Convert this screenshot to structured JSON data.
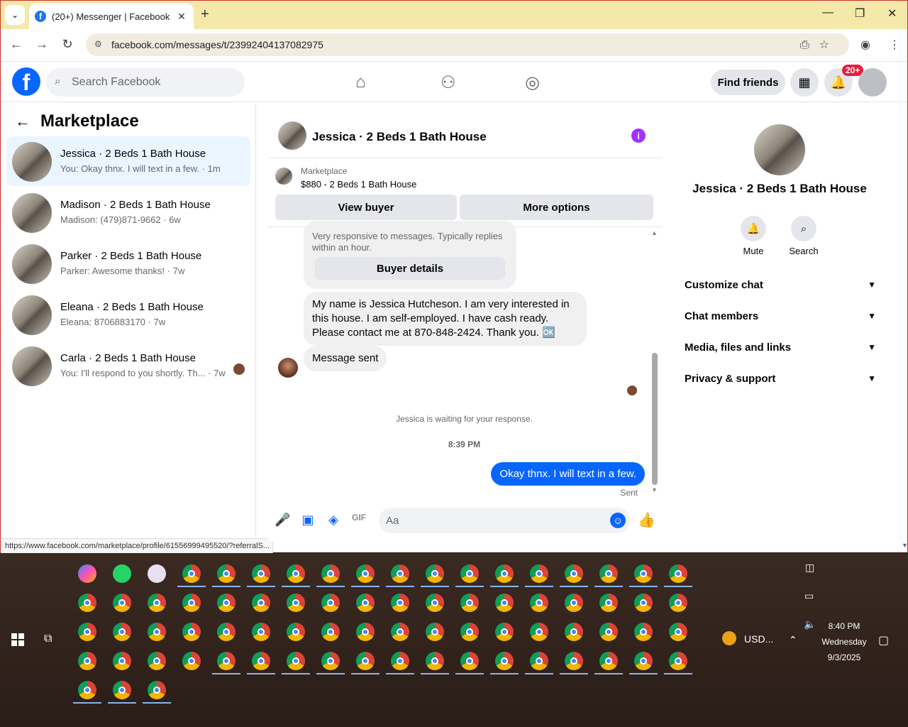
{
  "browser": {
    "tab_title": "(20+) Messenger | Facebook",
    "url": "facebook.com/messages/t/23992404137082975",
    "status_url": "https://www.facebook.com/marketplace/profile/61556999495520/?referralS..."
  },
  "fb": {
    "search_placeholder": "Search Facebook",
    "find_friends": "Find friends",
    "notif_badge": "20+"
  },
  "left": {
    "title": "Marketplace",
    "conversations": [
      {
        "name": "Jessica · 2 Beds 1 Bath House",
        "snippet": "You: Okay thnx. I will text in a few. · 1m"
      },
      {
        "name": "Madison · 2 Beds 1 Bath House",
        "snippet": "Madison: (479)871-9662 · 6w"
      },
      {
        "name": "Parker · 2 Beds 1 Bath House",
        "snippet": "Parker: Awesome thanks! · 7w"
      },
      {
        "name": "Eleana · 2 Beds 1 Bath House",
        "snippet": "Eleana: 8706883170 · 7w"
      },
      {
        "name": "Carla · 2 Beds 1 Bath House",
        "snippet": "You: I'll respond to you shortly. Th... · 7w"
      }
    ]
  },
  "chat": {
    "title": "Jessica · 2 Beds 1 Bath House",
    "listing_category": "Marketplace",
    "listing_price": "$880 - 2 Beds 1 Bath House",
    "view_buyer": "View buyer",
    "more_options": "More options",
    "responsive_text": "Very responsive to messages. Typically replies within an hour.",
    "buyer_details": "Buyer details",
    "msg1": "My name is Jessica Hutcheson. I am very interested in this house. I am self-employed. I have cash ready. Please contact me at 870-848-2424. Thank you. 🆗",
    "msg2": "Message sent",
    "waiting": "Jessica is waiting for your response.",
    "time": "8:39 PM",
    "my_msg": "Okay thnx. I will text in a few.",
    "sent": "Sent",
    "composer_placeholder": "Aa"
  },
  "right": {
    "name": "Jessica · 2 Beds 1 Bath House",
    "mute": "Mute",
    "search": "Search",
    "sections": [
      "Customize chat",
      "Chat members",
      "Media, files and links",
      "Privacy & support"
    ]
  },
  "taskbar": {
    "tray_currency": "USD...",
    "time": "8:40 PM",
    "day": "Wednesday",
    "date": "9/3/2025"
  }
}
